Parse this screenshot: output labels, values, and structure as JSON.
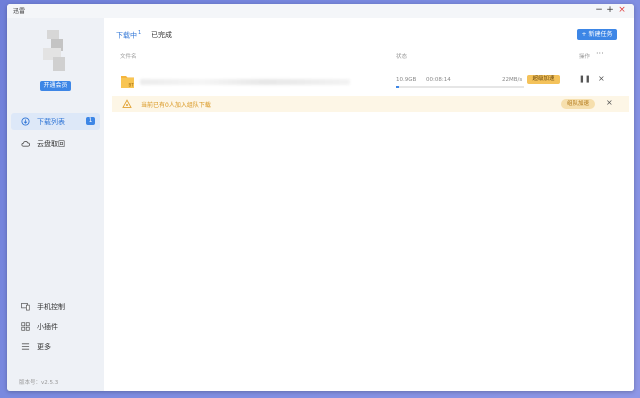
{
  "window": {
    "title": "迅雷"
  },
  "controls": {
    "minimize": "−",
    "maximize": "+",
    "close": "×"
  },
  "sidebar": {
    "vip_button": "开通会员",
    "items": [
      {
        "label": "下载列表",
        "badge": "1",
        "icon": "download-icon",
        "active": true
      },
      {
        "label": "云盘取回",
        "icon": "cloud-icon",
        "active": false
      }
    ],
    "bottom_items": [
      {
        "label": "手机控制",
        "icon": "phone-device-icon"
      },
      {
        "label": "小插件",
        "icon": "grid-icon"
      },
      {
        "label": "更多",
        "icon": "menu-icon"
      }
    ],
    "version": "版本号：v2.5.3"
  },
  "main": {
    "tabs": [
      {
        "label": "下载中",
        "count": "1",
        "active": true
      },
      {
        "label": "已完成",
        "active": false
      }
    ],
    "new_task_button": "+ 新建任务",
    "columns": {
      "name": "文件名",
      "status": "状态",
      "action": "操作",
      "more": "···"
    },
    "downloads": [
      {
        "size": "10.9GB",
        "time": "00:08:14",
        "speed": "22MB/s",
        "progress": 0.02,
        "boost_label": "超级加速",
        "pause": "❚❚",
        "cancel": "×"
      }
    ],
    "notice": {
      "text": "当前已有0人加入组队下载",
      "button": "组队加速",
      "close": "×"
    }
  },
  "colors": {
    "accent": "#3d86e6",
    "warning_text": "#d8941a",
    "notice_bg": "#fdf6e6",
    "boost": "#f4c25a"
  }
}
